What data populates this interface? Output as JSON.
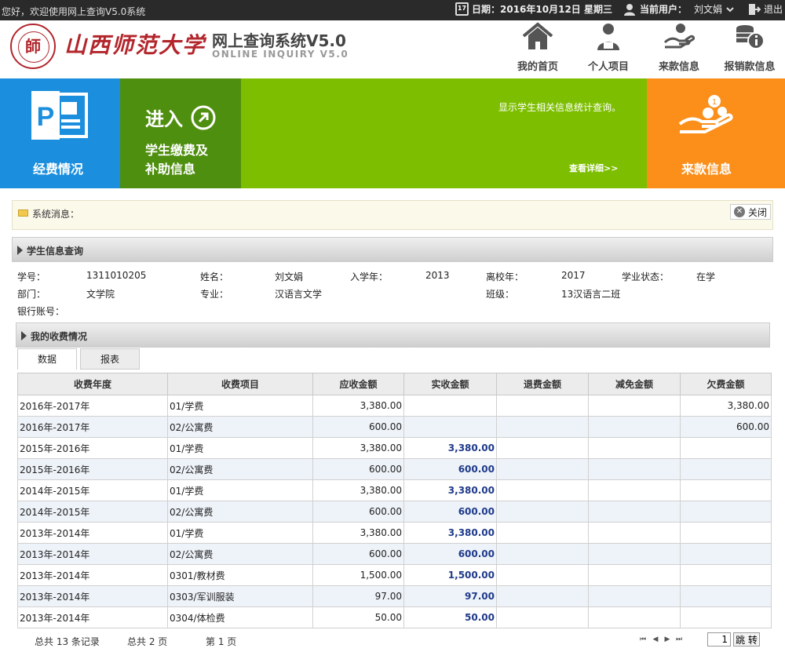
{
  "topbar": {
    "welcome": "您好，欢迎使用网上查询V5.0系统",
    "date_label": "日期：2016年10月12日 星期三",
    "user_label": "当前用户：",
    "user_name": "刘文娟",
    "logout": "退出"
  },
  "header": {
    "university_name": "山西师范大学",
    "system_title": "网上查询系统V5.0",
    "system_subtitle": "ONLINE INQUIRY V5.0",
    "nav": [
      {
        "label": "我的首页",
        "icon": "home-icon"
      },
      {
        "label": "个人项目",
        "icon": "user-icon"
      },
      {
        "label": "来款信息",
        "icon": "hand-money-icon"
      },
      {
        "label": "报销款信息",
        "icon": "coins-info-icon"
      }
    ]
  },
  "banner": {
    "tile1_label": "经费情况",
    "tile2_enter": "进入",
    "tile2_line1": "学生缴费及",
    "tile2_line2": "补助信息",
    "tile3_desc": "显示学生相关信息统计查询。",
    "tile3_more": "查看详细>>",
    "tile4_label": "来款信息"
  },
  "sysmsg": {
    "label": "系统消息：",
    "close": "关闭"
  },
  "student_section": {
    "title": "学生信息查询",
    "labels": {
      "id": "学号：",
      "name": "姓名：",
      "enroll_year": "入学年：",
      "leave_year": "离校年：",
      "status": "学业状态：",
      "dept": "部门：",
      "major": "专业：",
      "class": "班级：",
      "bank": "银行账号："
    },
    "values": {
      "id": "1311010205",
      "name": "刘文娟",
      "enroll_year": "2013",
      "leave_year": "2017",
      "status": "在学",
      "dept": "文学院",
      "major": "汉语言文学",
      "class": "13汉语言二班",
      "bank": ""
    }
  },
  "fee_section": {
    "title": "我的收费情况",
    "tabs": [
      "数据",
      "报表"
    ],
    "columns": [
      "收费年度",
      "收费项目",
      "应收金额",
      "实收金额",
      "退费金额",
      "减免金额",
      "欠费金额"
    ],
    "rows": [
      [
        "2016年-2017年",
        "01/学费",
        "3,380.00",
        "",
        "",
        "",
        "3,380.00"
      ],
      [
        "2016年-2017年",
        "02/公寓费",
        "600.00",
        "",
        "",
        "",
        "600.00"
      ],
      [
        "2015年-2016年",
        "01/学费",
        "3,380.00",
        "3,380.00",
        "",
        "",
        ""
      ],
      [
        "2015年-2016年",
        "02/公寓费",
        "600.00",
        "600.00",
        "",
        "",
        ""
      ],
      [
        "2014年-2015年",
        "01/学费",
        "3,380.00",
        "3,380.00",
        "",
        "",
        ""
      ],
      [
        "2014年-2015年",
        "02/公寓费",
        "600.00",
        "600.00",
        "",
        "",
        ""
      ],
      [
        "2013年-2014年",
        "01/学费",
        "3,380.00",
        "3,380.00",
        "",
        "",
        ""
      ],
      [
        "2013年-2014年",
        "02/公寓费",
        "600.00",
        "600.00",
        "",
        "",
        ""
      ],
      [
        "2013年-2014年",
        "0301/教材费",
        "1,500.00",
        "1,500.00",
        "",
        "",
        ""
      ],
      [
        "2013年-2014年",
        "0303/军训服装",
        "97.00",
        "97.00",
        "",
        "",
        ""
      ],
      [
        "2013年-2014年",
        "0304/体检费",
        "50.00",
        "50.00",
        "",
        "",
        ""
      ]
    ]
  },
  "pager": {
    "total_records": "总共  13  条记录",
    "total_pages": "总共   2 页",
    "current_page": "第   1 页",
    "page_input": "1",
    "go_label": "跳 转"
  }
}
